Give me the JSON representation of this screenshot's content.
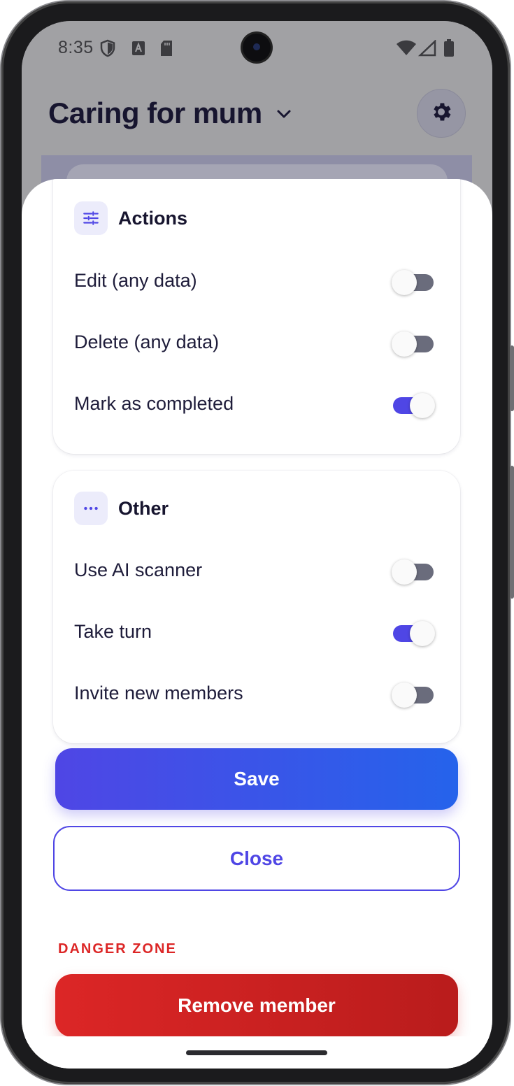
{
  "status_bar": {
    "time": "8:35",
    "left_icons": [
      "shield-icon",
      "a-badge-icon",
      "sd-card-icon"
    ],
    "right_icons": [
      "wifi-icon",
      "signal-icon",
      "battery-icon"
    ]
  },
  "header": {
    "title": "Caring for mum",
    "chevron_icon": "chevron-down-icon",
    "settings_icon": "gear-icon"
  },
  "sheet": {
    "sections": [
      {
        "title": "Actions",
        "icon": "sliders-icon",
        "items": [
          {
            "label": "Edit (any data)",
            "enabled": false
          },
          {
            "label": "Delete (any data)",
            "enabled": false
          },
          {
            "label": "Mark as completed",
            "enabled": true
          }
        ]
      },
      {
        "title": "Other",
        "icon": "more-horizontal-icon",
        "items": [
          {
            "label": "Use AI scanner",
            "enabled": false
          },
          {
            "label": "Take turn",
            "enabled": true
          },
          {
            "label": "Invite new members",
            "enabled": false
          }
        ]
      }
    ],
    "save_label": "Save",
    "close_label": "Close",
    "danger_zone_label": "DANGER ZONE",
    "remove_label": "Remove member"
  },
  "colors": {
    "accent": "#4f46e5",
    "accent_end": "#2563eb",
    "danger": "#dc2626",
    "toggle_off_track": "#6a6c7c",
    "text_primary": "#17152f"
  }
}
